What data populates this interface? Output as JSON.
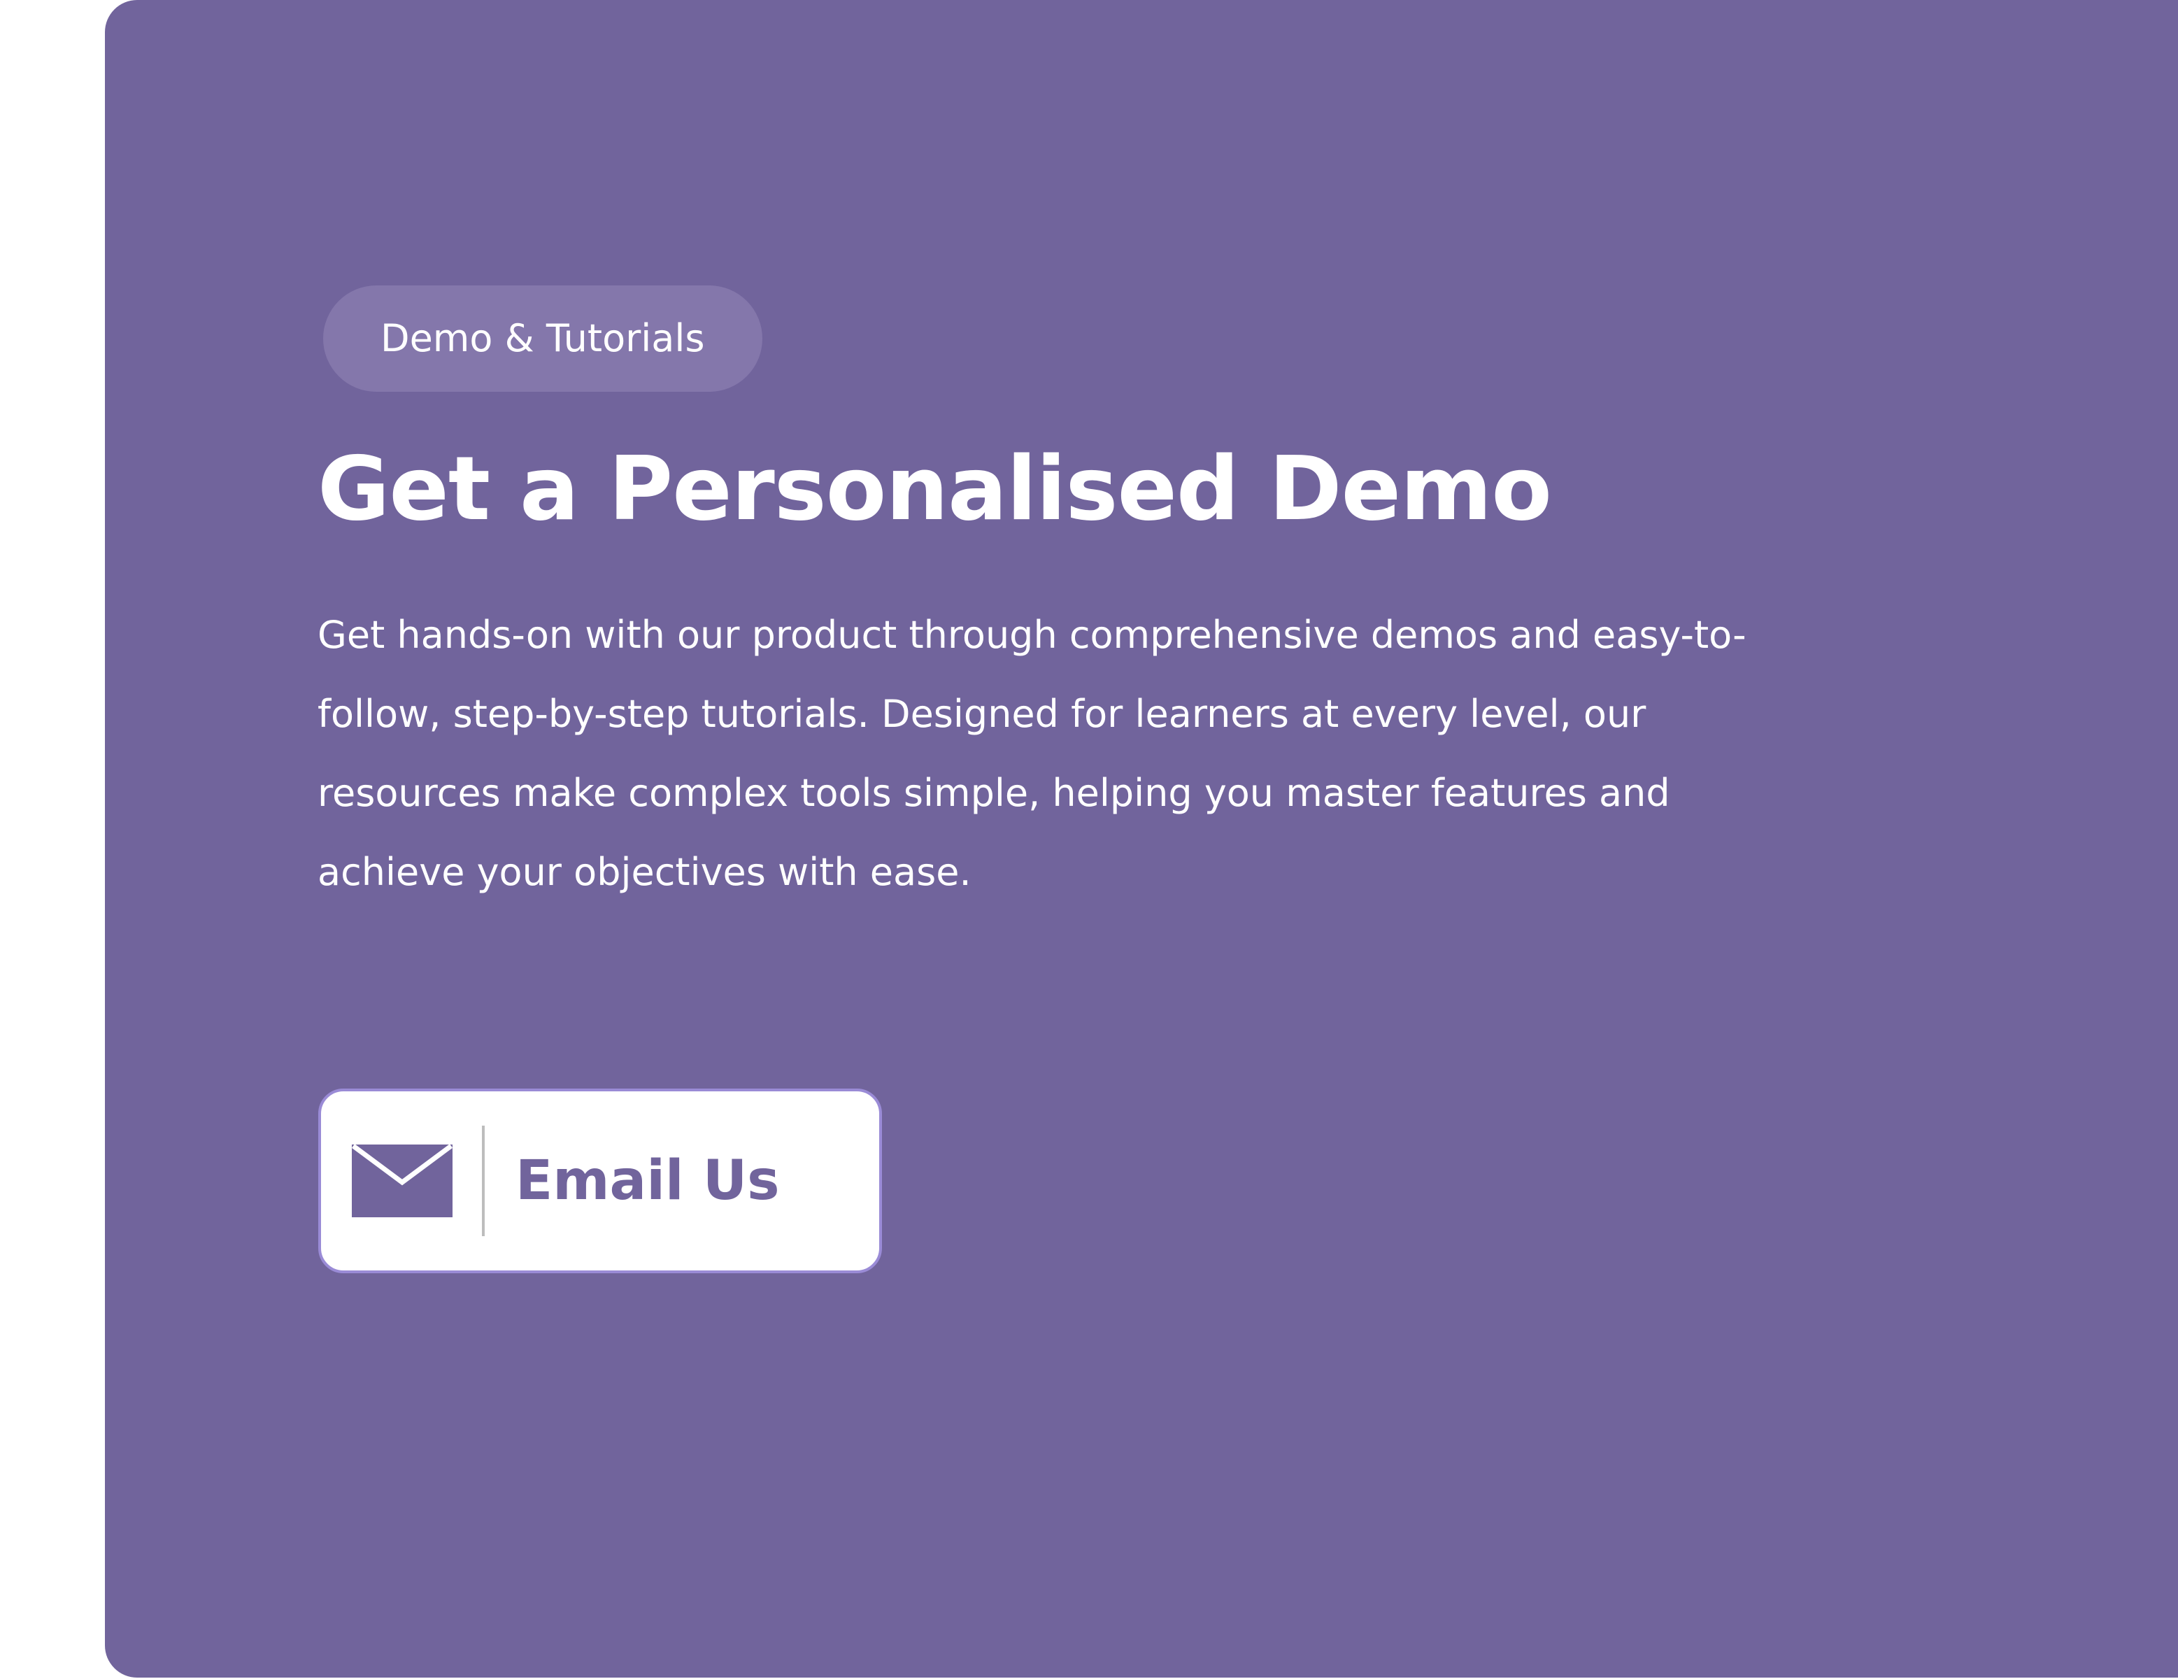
{
  "badge": {
    "label": "Demo & Tutorials"
  },
  "hero": {
    "title": "Get a Personalised Demo",
    "description": "Get hands-on with our product through comprehensive demos and easy-to-follow, step-by-step tutorials. Designed for learners at every level, our resources make complex tools simple, helping you master features and achieve your objectives with ease."
  },
  "email_button": {
    "label": "Email Us",
    "icon": "envelope-icon"
  },
  "colors": {
    "panel": "#71649C",
    "badge": "#8477AB",
    "button_border": "#9A8BD6",
    "text": "#FFFFFF"
  }
}
